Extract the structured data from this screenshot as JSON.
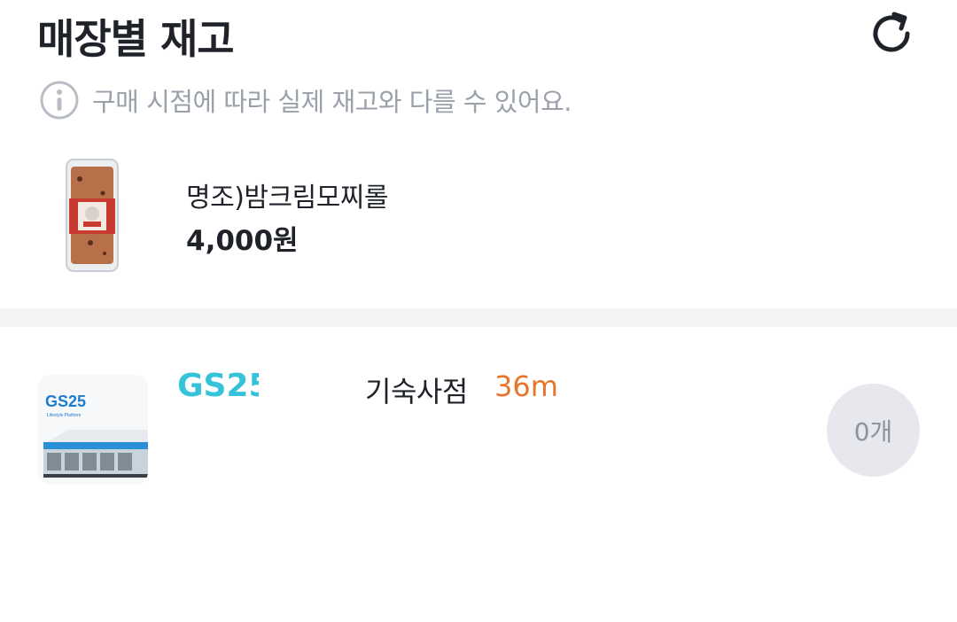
{
  "header": {
    "title": "매장별 재고",
    "refresh_icon": "refresh-icon"
  },
  "notice": {
    "icon": "info-icon",
    "text": "구매 시점에 따라 실제 재고와 다를 수 있어요."
  },
  "product": {
    "name": "명조)밤크림모찌롤",
    "price": "4,000원"
  },
  "stores": [
    {
      "brand": "GS25",
      "branch": "기숙사점",
      "distance": "36m",
      "stock": "0개"
    }
  ],
  "colors": {
    "brand": "#34c3d8",
    "distance": "#e8742a",
    "stock_badge_bg": "#e6e8ee",
    "divider": "#f2f3f5"
  }
}
